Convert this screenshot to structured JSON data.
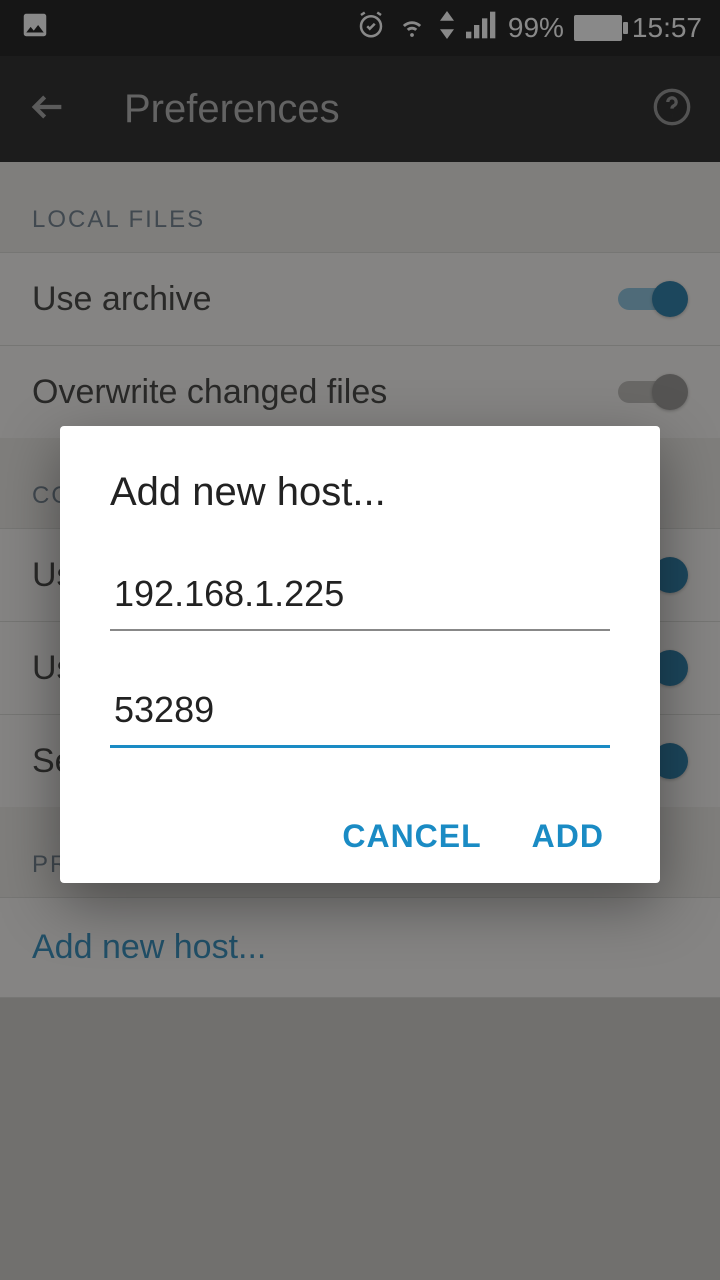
{
  "status": {
    "battery_pct": "99%",
    "time": "15:57"
  },
  "appbar": {
    "title": "Preferences"
  },
  "sections": {
    "local_files": {
      "header": "LOCAL FILES",
      "use_archive": "Use archive",
      "overwrite": "Overwrite changed files"
    },
    "co": {
      "header": "CO",
      "row1": "Us",
      "row2": "Us",
      "row3": "Se"
    },
    "pr": {
      "header": "PR",
      "add_new_host": "Add new host..."
    }
  },
  "dialog": {
    "title": "Add new host...",
    "host_value": "192.168.1.225",
    "port_value": "53289",
    "cancel": "CANCEL",
    "add": "ADD"
  }
}
